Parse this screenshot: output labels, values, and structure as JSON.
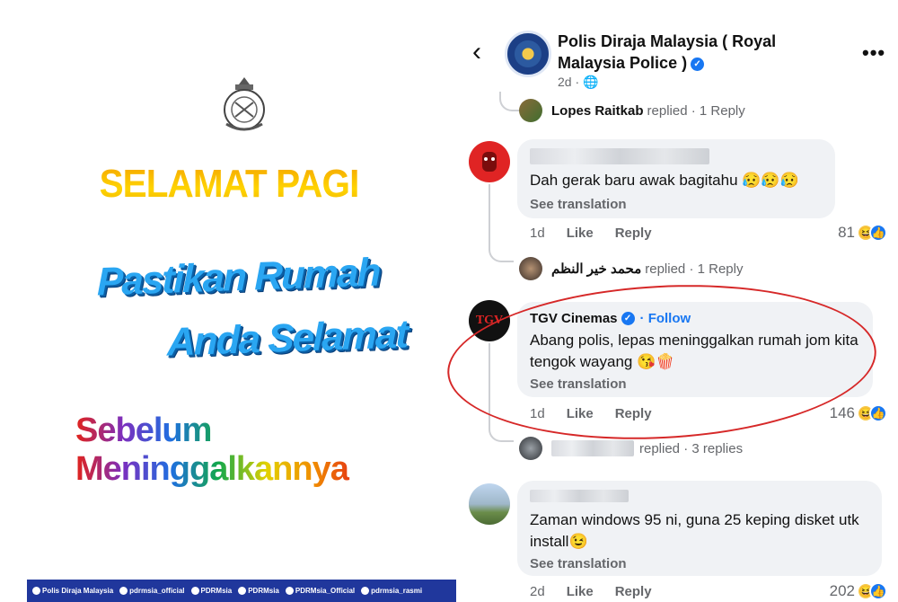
{
  "poster": {
    "greeting": "SELAMAT PAGI",
    "line1": "Pastikan Rumah",
    "line2": "Anda Selamat",
    "line3": "Sebelum Meninggalkannya",
    "footer": [
      "Polis Diraja Malaysia",
      "pdrmsia_official",
      "PDRMsia",
      "PDRMsia",
      "PDRMsia_Official",
      "pdrmsia_rasmi"
    ]
  },
  "header": {
    "page_name": "Polis Diraja Malaysia ( Royal Malaysia Police )",
    "time": "2d"
  },
  "replies_top": {
    "name": "Lopes Raitkab",
    "replied": "replied",
    "count": "· 1 Reply"
  },
  "comment1": {
    "text": "Dah gerak baru awak bagitahu 😥😥😥",
    "see": "See translation",
    "time": "1d",
    "like": "Like",
    "reply": "Reply",
    "reactions": "81"
  },
  "replies_mid": {
    "name": "محمد خير النظم",
    "replied": "replied",
    "count": "· 1 Reply"
  },
  "comment2": {
    "name": "TGV Cinemas",
    "follow": "· Follow",
    "avatar_text": "TGV",
    "text": "Abang polis, lepas meninggalkan rumah jom kita tengok wayang 😘🍿",
    "see": "See translation",
    "time": "1d",
    "like": "Like",
    "reply": "Reply",
    "reactions": "146"
  },
  "replies_tgv": {
    "replied": "replied",
    "count": "· 3 replies"
  },
  "comment3": {
    "text": "Zaman windows 95 ni, guna 25 keping disket utk install😉",
    "see": "See translation",
    "time": "2d",
    "like": "Like",
    "reply": "Reply",
    "reactions": "202"
  },
  "colors": {
    "accent": "#1877f2",
    "circle": "#d62828",
    "footer": "#20379c"
  }
}
